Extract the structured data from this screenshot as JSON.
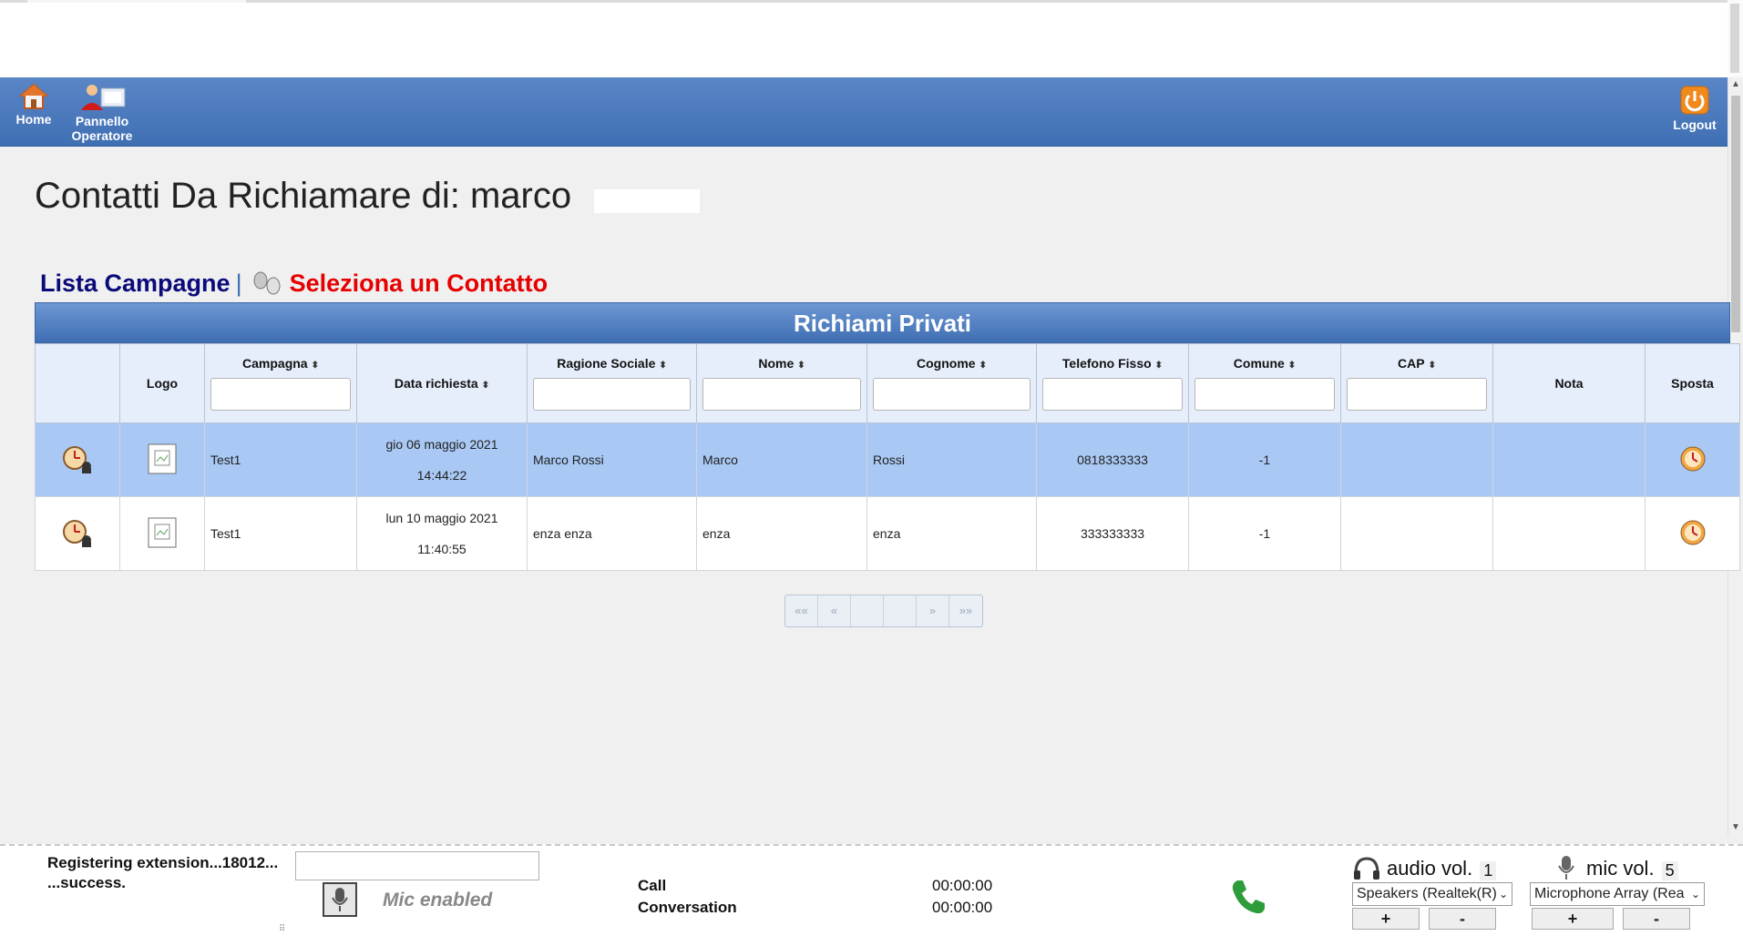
{
  "nav": {
    "home_label": "Home",
    "operator_label": "Pannello",
    "operator_label2": "Operatore",
    "logout_label": "Logout"
  },
  "page": {
    "title": "Contatti Da Richiamare di: marco"
  },
  "breadcrumb": {
    "campaigns_link": "Lista Campagne",
    "separator": "|",
    "current": "Seleziona un Contatto"
  },
  "table": {
    "title": "Richiami Privati",
    "headers": {
      "logo": "Logo",
      "campagna": "Campagna",
      "data": "Data richiesta",
      "ragione": "Ragione Sociale",
      "nome": "Nome",
      "cognome": "Cognome",
      "telefono": "Telefono Fisso",
      "comune": "Comune",
      "cap": "CAP",
      "nota": "Nota",
      "sposta": "Sposta"
    },
    "rows": [
      {
        "campagna": "Test1",
        "data_date": "gio 06 maggio 2021",
        "data_time": "14:44:22",
        "ragione": "Marco Rossi",
        "nome": "Marco",
        "cognome": "Rossi",
        "telefono": "0818333333",
        "comune": "-1",
        "cap": "",
        "nota": ""
      },
      {
        "campagna": "Test1",
        "data_date": "lun 10 maggio 2021",
        "data_time": "11:40:55",
        "ragione": "enza enza",
        "nome": "enza",
        "cognome": "enza",
        "telefono": "333333333",
        "comune": "-1",
        "cap": "",
        "nota": ""
      }
    ]
  },
  "pager": {
    "first": "««",
    "prev": "«",
    "next": "»",
    "last": "»»"
  },
  "footer": {
    "reg_line1": "Registering extension...18012...",
    "reg_line2": "...success.",
    "mic_status": "Mic enabled",
    "call_label": "Call",
    "conversation_label": "Conversation",
    "call_time": "00:00:00",
    "conversation_time": "00:00:00",
    "audio_label": "audio vol.",
    "audio_value": "1",
    "mic_label": "mic vol.",
    "mic_value": "5",
    "speaker_device": "Speakers (Realtek(R)",
    "mic_device": "Microphone Array (Rea",
    "plus": "+",
    "minus": "-"
  }
}
